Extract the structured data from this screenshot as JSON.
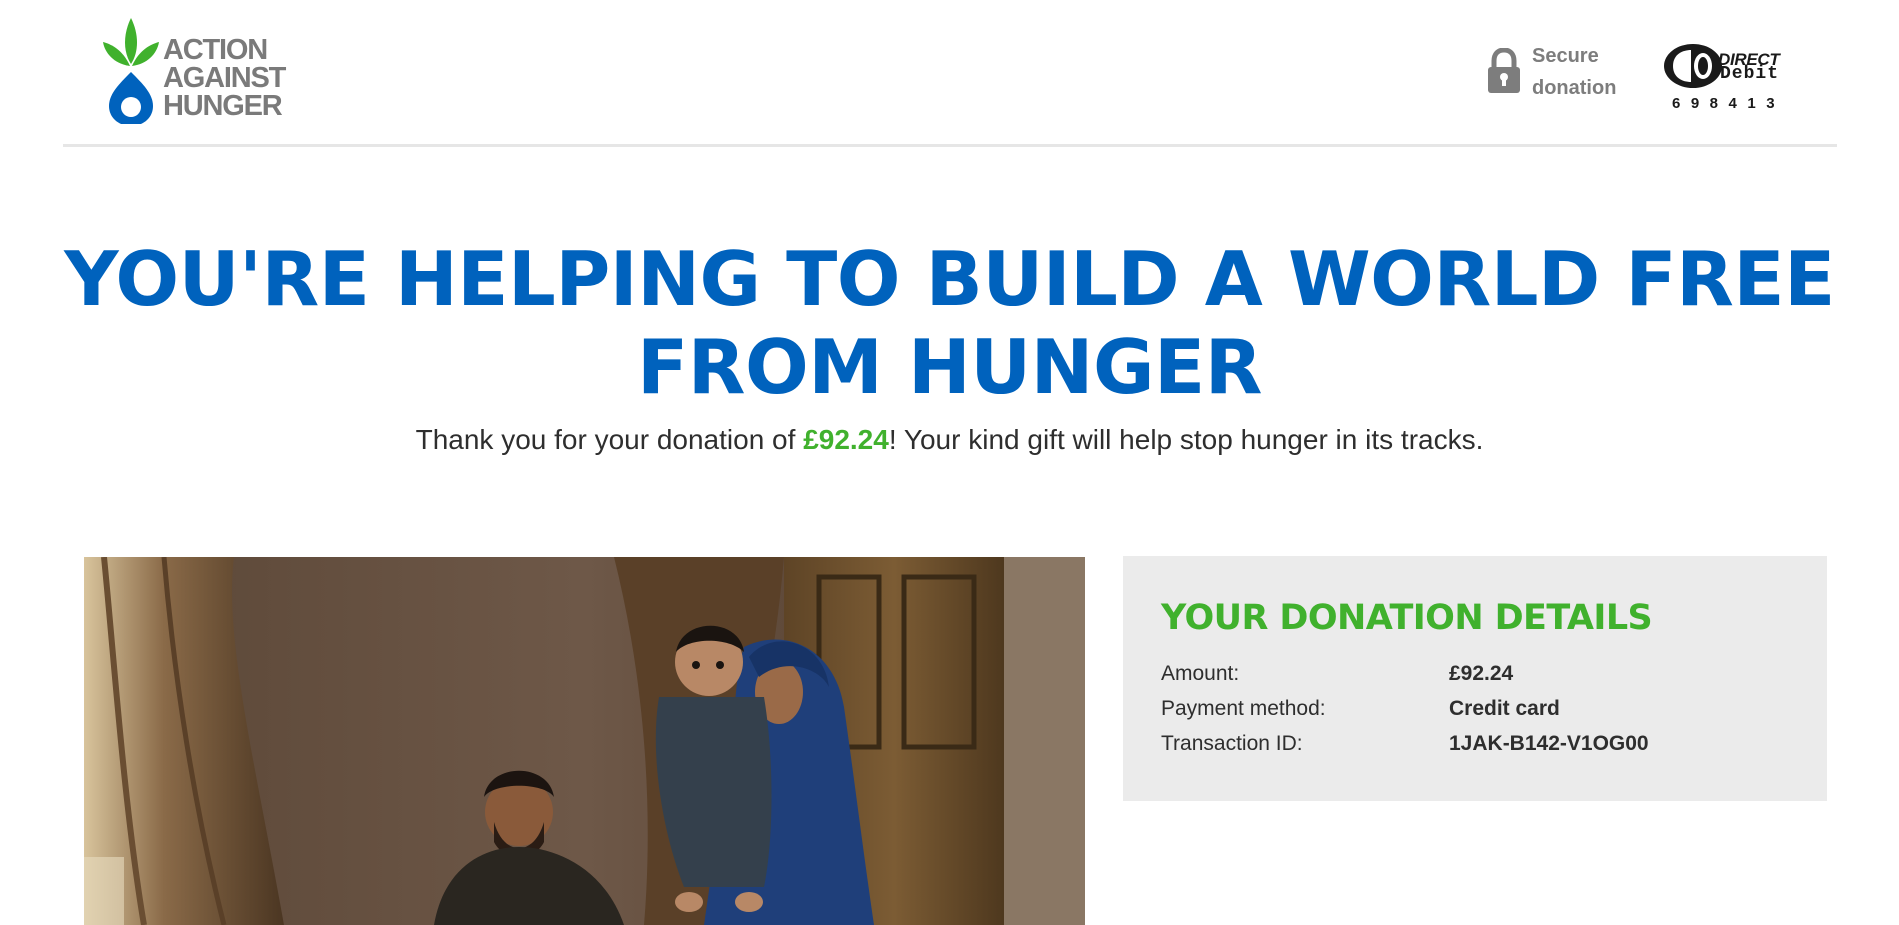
{
  "header": {
    "logo": {
      "line1": "ACTION",
      "line2": "AGAINST",
      "line3": "HUNGER",
      "icon": "leaf-and-drop-logo",
      "leaf_color": "#40b12d",
      "drop_color": "#0062bd"
    },
    "secure": {
      "icon": "padlock-icon",
      "line1": "Secure",
      "line2": "donation"
    },
    "direct_debit": {
      "icon": "direct-debit-logo",
      "word1": "DIRECT",
      "word2": "Debit",
      "code": "698413"
    }
  },
  "hero": {
    "headline_line1": "YOU'RE HELPING TO BUILD A WORLD FREE",
    "headline_line2": "FROM HUNGER",
    "thanks_before": "Thank you for your donation of ",
    "thanks_amount": "£92.24",
    "thanks_after": "! Your kind gift will help stop hunger in its tracks.",
    "headline_color": "#0062bd",
    "amount_color": "#40b12d"
  },
  "photo": {
    "icon": "family-photo"
  },
  "details": {
    "title": "YOUR DONATION DETAILS",
    "rows": [
      {
        "label": "Amount:",
        "value": "£92.24"
      },
      {
        "label": "Payment method:",
        "value": "Credit card"
      },
      {
        "label": "Transaction ID:",
        "value": "1JAK-B142-V1OG00"
      }
    ],
    "title_color": "#40b12d",
    "background": "#ebebeb"
  }
}
